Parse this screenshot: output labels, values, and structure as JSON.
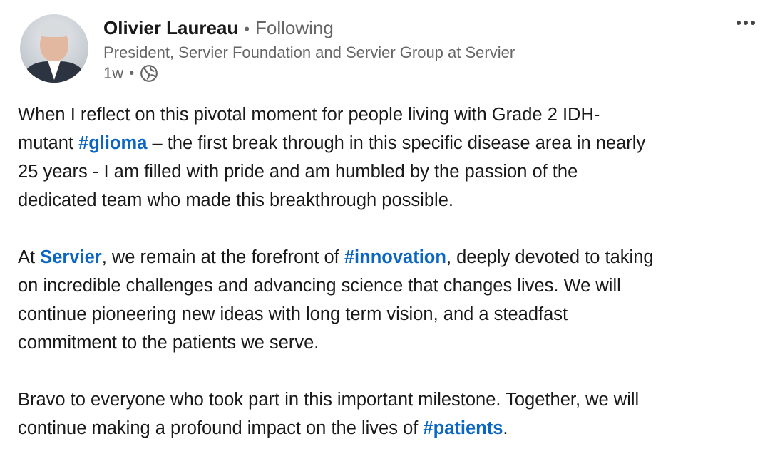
{
  "author": {
    "name": "Olivier Laureau",
    "separator": "•",
    "follow_status": "Following",
    "headline": "President, Servier Foundation and Servier Group at Servier"
  },
  "meta": {
    "time": "1w",
    "separator": "•",
    "visibility_icon": "globe-icon"
  },
  "post": {
    "p1": {
      "l1": "When I reflect on this pivotal moment for people living with Grade 2 IDH-",
      "l2_pre": "mutant ",
      "tag_glioma": "#glioma",
      "l2_post": " – the first break through in this specific disease area in nearly",
      "l3": "25 years - I am filled with pride and am humbled by the passion of the",
      "l4": "dedicated team who made this breakthrough possible."
    },
    "p2": {
      "l1_pre": "At ",
      "mention_servier": "Servier",
      "l1_mid": ", we remain at the forefront of ",
      "tag_innovation": "#innovation",
      "l1_post": ", deeply devoted to taking",
      "l2": "on incredible challenges and advancing science that changes lives. We will",
      "l3": "continue pioneering new ideas with long term vision, and a steadfast",
      "l4": "commitment to the patients we serve."
    },
    "p3": {
      "l1": "Bravo to everyone who took part in this important milestone. Together, we will",
      "l2_pre": "continue making a profound impact on the lives of ",
      "tag_patients": "#patients",
      "l2_post": "."
    }
  },
  "colors": {
    "link": "#0a66c2",
    "secondary_text": "#666666"
  }
}
